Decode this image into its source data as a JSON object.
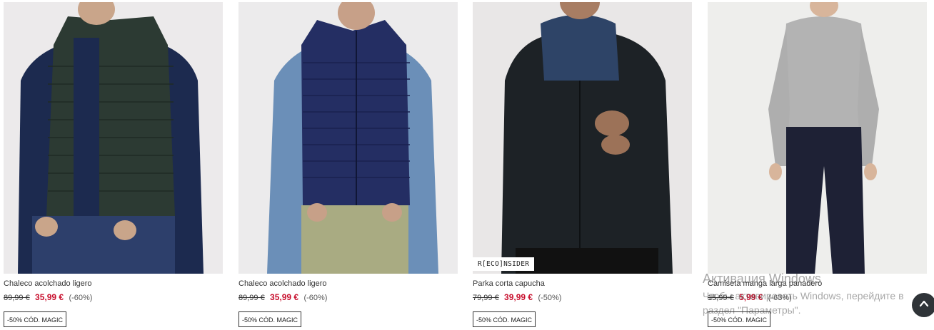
{
  "products": [
    {
      "name": "Chaleco acolchado ligero",
      "old_price": "89,99 €",
      "price": "35,99 €",
      "discount": "(-60%)",
      "badge": "-50% CÓD. MAGIC",
      "tag": "",
      "image": "man-green-puffer-vest"
    },
    {
      "name": "Chaleco acolchado ligero",
      "old_price": "89,99 €",
      "price": "35,99 €",
      "discount": "(-60%)",
      "badge": "-50% CÓD. MAGIC",
      "tag": "",
      "image": "man-navy-puffer-vest"
    },
    {
      "name": "Parka corta capucha",
      "old_price": "79,99 €",
      "price": "39,99 €",
      "discount": "(-50%)",
      "badge": "-50% CÓD. MAGIC",
      "tag": "R[ECO]NSIDER",
      "image": "man-black-parka"
    },
    {
      "name": "Camiseta manga larga panadero",
      "old_price": "15,99 €",
      "price": "5,99 €",
      "discount": "(-63%)",
      "badge": "-50% CÓD. MAGIC",
      "tag": "",
      "image": "man-grey-henley-shirt"
    }
  ],
  "os_watermark": {
    "title": "Активация Windows",
    "line1": "Чтобы активировать Windows, перейдите в",
    "line2": "раздел \"Параметры\"."
  },
  "scroll_top": {
    "icon": "chevron-up-icon"
  },
  "colors": {
    "sale_price": "#c8102e",
    "button_bg": "#2f3438"
  }
}
